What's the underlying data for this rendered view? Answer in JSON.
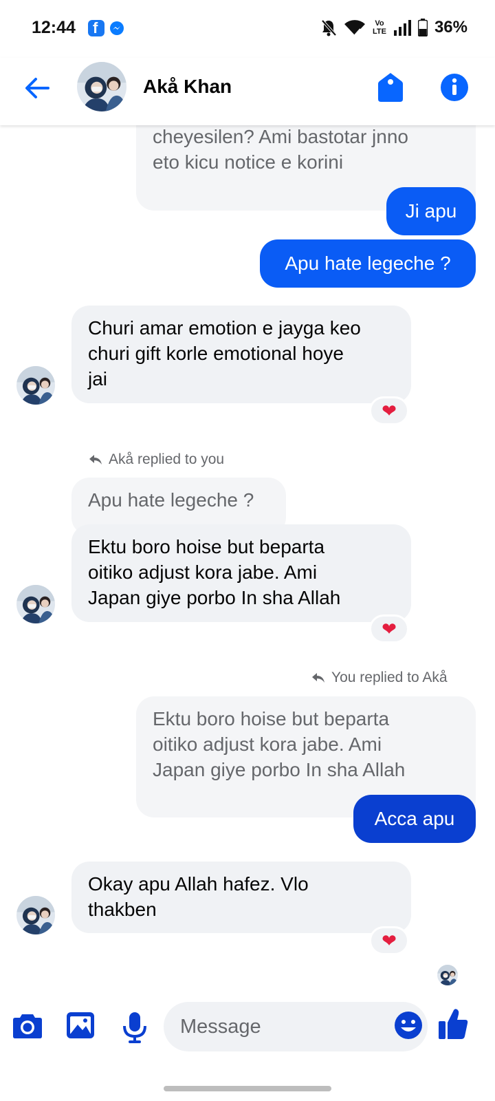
{
  "status_bar": {
    "time": "12:44",
    "battery": "36%",
    "network_label_top": "Vo",
    "network_label_bottom": "LTE",
    "fb_badge": "f"
  },
  "header": {
    "contact_name": "Akå Khan",
    "back_icon": "arrow-left-icon",
    "tag_icon": "tag-icon",
    "info_icon": "info-icon"
  },
  "messages": [
    {
      "kind": "incoming-partial",
      "text_line1": "cheyesilen? Ami bastotar jnno",
      "text_line2": "eto kicu notice e korini"
    },
    {
      "kind": "outgoing",
      "text": "Ji apu"
    },
    {
      "kind": "outgoing",
      "text": "Apu hate legeche ?"
    },
    {
      "kind": "incoming",
      "text_line1": "Churi amar emotion e jayga keo",
      "text_line2": "churi gift korle emotional hoye",
      "text_line3": "jai",
      "reaction": "❤"
    },
    {
      "kind": "incoming-reply",
      "reply_label": "Akå replied to you",
      "quoted": "Apu hate legeche ?",
      "text_line1": "Ektu boro hoise but beparta",
      "text_line2": "oitiko adjust kora jabe. Ami",
      "text_line3": "Japan giye porbo In sha Allah",
      "reaction": "❤"
    },
    {
      "kind": "outgoing-reply",
      "reply_label": "You replied to Akå",
      "quoted_line1": "Ektu boro hoise but beparta",
      "quoted_line2": "oitiko adjust kora jabe. Ami",
      "quoted_line3": "Japan giye porbo In sha Allah",
      "text": "Acca apu"
    },
    {
      "kind": "incoming",
      "text_line1": "Okay apu Allah hafez. Vlo",
      "text_line2": "thakben",
      "reaction": "❤"
    }
  ],
  "composer": {
    "placeholder": "Message",
    "camera_icon": "camera-icon",
    "gallery_icon": "image-icon",
    "mic_icon": "microphone-icon",
    "emoji_icon": "smiley-icon",
    "like_icon": "thumbs-up-icon"
  },
  "colors": {
    "accent": "#0a7cff",
    "outgoing_bubble": "#0a5cf5",
    "outgoing_bubble_dark": "#0a3fd0",
    "incoming_bubble": "#f0f2f5",
    "reaction_heart": "#e41e3f"
  }
}
